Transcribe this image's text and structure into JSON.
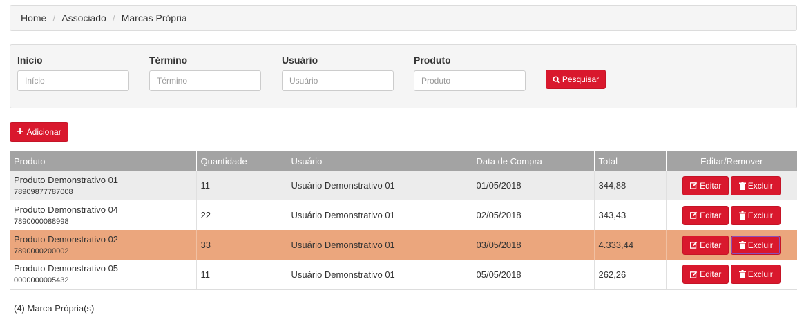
{
  "breadcrumb": [
    "Home",
    "Associado",
    "Marcas Própria"
  ],
  "filters": [
    {
      "label": "Início",
      "placeholder": "Início",
      "value": ""
    },
    {
      "label": "Término",
      "placeholder": "Término",
      "value": ""
    },
    {
      "label": "Usuário",
      "placeholder": "Usuário",
      "value": ""
    },
    {
      "label": "Produto",
      "placeholder": "Produto",
      "value": ""
    }
  ],
  "search_label": "Pesquisar",
  "add_label": "Adicionar",
  "table": {
    "headers": [
      "Produto",
      "Quantidade",
      "Usuário",
      "Data de Compra",
      "Total",
      "Editar/Remover"
    ],
    "rows": [
      {
        "produto": "Produto Demonstrativo 01",
        "codigo": "78909877787008",
        "quantidade": "11",
        "usuario": "Usuário Demonstrativo 01",
        "data": "01/05/2018",
        "total": "344,88",
        "edit": "Editar",
        "delete": "Excluir"
      },
      {
        "produto": "Produto Demonstrativo 04",
        "codigo": "7890000088998",
        "quantidade": "22",
        "usuario": "Usuário Demonstrativo 01",
        "data": "02/05/2018",
        "total": "343,43",
        "edit": "Editar",
        "delete": "Excluir"
      },
      {
        "produto": "Produto Demonstrativo 02",
        "codigo": "7890000200002",
        "quantidade": "33",
        "usuario": "Usuário Demonstrativo 01",
        "data": "03/05/2018",
        "total": "4.333,44",
        "edit": "Editar",
        "delete": "Excluir"
      },
      {
        "produto": "Produto Demonstrativo 05",
        "codigo": "0000000005432",
        "quantidade": "11",
        "usuario": "Usuário Demonstrativo 01",
        "data": "05/05/2018",
        "total": "262,26",
        "edit": "Editar",
        "delete": "Excluir"
      }
    ]
  },
  "footer_count": "(4) Marca Própria(s)",
  "colors": {
    "accent": "#d9182d",
    "header_bg": "#a3a3a3",
    "highlight_row": "#eba67d"
  },
  "icons": {
    "search": "search-icon",
    "add": "plus-icon",
    "edit": "edit-icon",
    "delete": "trash-icon"
  }
}
